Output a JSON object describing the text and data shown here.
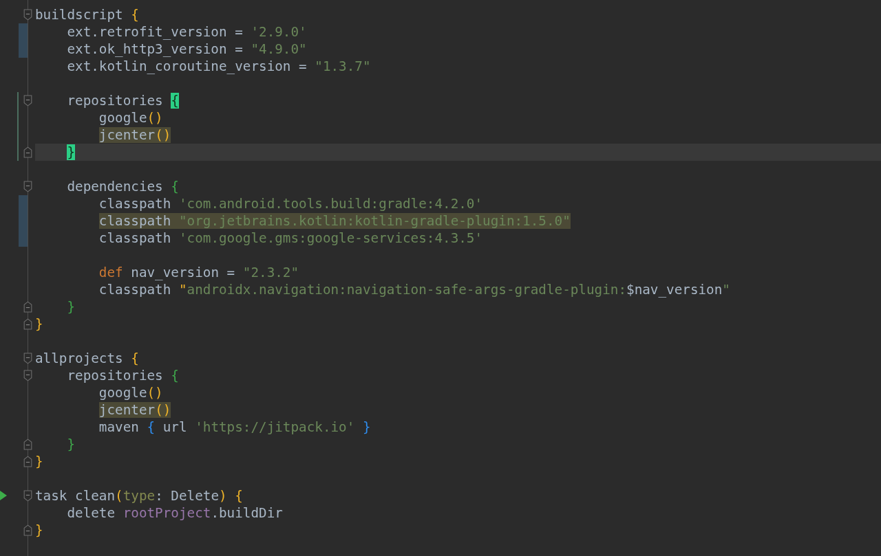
{
  "editor": {
    "lines": [
      {
        "kind": "code",
        "fold_start": true,
        "tokens": [
          {
            "text": "buildscript ",
            "kind": "plain"
          },
          {
            "text": "{",
            "kind": "brace-outer"
          }
        ],
        "children": [
          {
            "kind": "code",
            "modified": true,
            "tokens": [
              {
                "text": "ext.retrofit_version = ",
                "kind": "plain"
              },
              {
                "text": "'2.9.0'",
                "kind": "string"
              }
            ]
          },
          {
            "kind": "code",
            "modified": true,
            "tokens": [
              {
                "text": "ext.ok_http3_version = ",
                "kind": "plain"
              },
              {
                "text": "\"4.9.0\"",
                "kind": "string"
              }
            ]
          },
          {
            "kind": "code",
            "tokens": [
              {
                "text": "ext.kotlin_coroutine_version = ",
                "kind": "plain"
              },
              {
                "text": "\"1.3.7\"",
                "kind": "string"
              }
            ]
          },
          {
            "kind": "blank"
          },
          {
            "kind": "code",
            "fold_start": true,
            "added": true,
            "tokens": [
              {
                "text": "repositories ",
                "kind": "plain"
              },
              {
                "text": "{",
                "kind": "brace-inner",
                "matched": true
              }
            ],
            "children": [
              {
                "kind": "code",
                "added": true,
                "tokens": [
                  {
                    "text": "google",
                    "kind": "plain"
                  },
                  {
                    "text": "()",
                    "kind": "brace-outer"
                  }
                ]
              },
              {
                "kind": "code",
                "added": true,
                "tokens": [
                  {
                    "text": "jcenter",
                    "kind": "plain",
                    "highlighted": true
                  },
                  {
                    "text": "()",
                    "kind": "brace-outer",
                    "highlighted": true
                  }
                ]
              }
            ]
          },
          {
            "kind": "code",
            "fold_end": true,
            "added": true,
            "current": true,
            "tokens": [
              {
                "text": "}",
                "kind": "brace-inner",
                "matched": true
              }
            ]
          },
          {
            "kind": "blank"
          },
          {
            "kind": "code",
            "fold_start": true,
            "tokens": [
              {
                "text": "dependencies ",
                "kind": "plain"
              },
              {
                "text": "{",
                "kind": "brace-inner"
              }
            ],
            "children": [
              {
                "kind": "code",
                "modified": true,
                "tokens": [
                  {
                    "text": "classpath ",
                    "kind": "plain"
                  },
                  {
                    "text": "'com.android.tools.build:gradle:4.2.0'",
                    "kind": "string"
                  }
                ]
              },
              {
                "kind": "code",
                "modified": true,
                "tokens": [
                  {
                    "text": "classpath ",
                    "kind": "plain",
                    "highlighted": true
                  },
                  {
                    "text": "\"org.jetbrains.kotlin:kotlin-gradle-plugin:1.5.0\"",
                    "kind": "string",
                    "highlighted": true
                  }
                ]
              },
              {
                "kind": "code",
                "modified": true,
                "tokens": [
                  {
                    "text": "classpath ",
                    "kind": "plain"
                  },
                  {
                    "text": "'com.google.gms:google-services:4.3.5'",
                    "kind": "string"
                  }
                ]
              },
              {
                "kind": "blank"
              },
              {
                "kind": "code",
                "tokens": [
                  {
                    "text": "def",
                    "kind": "keyword"
                  },
                  {
                    "text": " nav_version = ",
                    "kind": "plain"
                  },
                  {
                    "text": "\"2.3.2\"",
                    "kind": "string"
                  }
                ]
              },
              {
                "kind": "code",
                "tokens": [
                  {
                    "text": "classpath ",
                    "kind": "plain"
                  },
                  {
                    "text": "\"",
                    "kind": "brace-outer"
                  },
                  {
                    "text": "androidx.navigation:navigation-safe-args-gradle-plugin:",
                    "kind": "string"
                  },
                  {
                    "text": "$nav_version",
                    "kind": "plain"
                  },
                  {
                    "text": "\"",
                    "kind": "string"
                  }
                ]
              }
            ]
          },
          {
            "kind": "code",
            "fold_end": true,
            "tokens": [
              {
                "text": "}",
                "kind": "brace-inner"
              }
            ]
          }
        ]
      },
      {
        "kind": "code",
        "fold_end": true,
        "tokens": [
          {
            "text": "}",
            "kind": "brace-outer"
          }
        ]
      },
      {
        "kind": "blank"
      },
      {
        "kind": "code",
        "fold_start": true,
        "tokens": [
          {
            "text": "allprojects ",
            "kind": "plain"
          },
          {
            "text": "{",
            "kind": "brace-outer"
          }
        ],
        "children": [
          {
            "kind": "code",
            "fold_start": true,
            "tokens": [
              {
                "text": "repositories ",
                "kind": "plain"
              },
              {
                "text": "{",
                "kind": "brace-inner"
              }
            ],
            "children": [
              {
                "kind": "code",
                "tokens": [
                  {
                    "text": "google",
                    "kind": "plain"
                  },
                  {
                    "text": "()",
                    "kind": "brace-outer"
                  }
                ]
              },
              {
                "kind": "code",
                "tokens": [
                  {
                    "text": "jcenter",
                    "kind": "plain",
                    "highlighted": true
                  },
                  {
                    "text": "()",
                    "kind": "brace-outer",
                    "highlighted": true
                  }
                ]
              },
              {
                "kind": "code",
                "tokens": [
                  {
                    "text": "maven ",
                    "kind": "plain"
                  },
                  {
                    "text": "{",
                    "kind": "brace-block"
                  },
                  {
                    "text": " url ",
                    "kind": "plain"
                  },
                  {
                    "text": "'https://jitpack.io'",
                    "kind": "string"
                  },
                  {
                    "text": " }",
                    "kind": "brace-block"
                  }
                ]
              }
            ]
          },
          {
            "kind": "code",
            "fold_end": true,
            "tokens": [
              {
                "text": "}",
                "kind": "brace-inner"
              }
            ]
          }
        ]
      },
      {
        "kind": "code",
        "fold_end": true,
        "tokens": [
          {
            "text": "}",
            "kind": "brace-outer"
          }
        ]
      },
      {
        "kind": "blank"
      },
      {
        "kind": "code",
        "fold_start": true,
        "run": true,
        "tokens": [
          {
            "text": "task clean",
            "kind": "plain"
          },
          {
            "text": "(",
            "kind": "brace-outer"
          },
          {
            "text": "type",
            "kind": "param"
          },
          {
            "text": ": Delete",
            "kind": "plain"
          },
          {
            "text": ")",
            "kind": "brace-outer"
          },
          {
            "text": " {",
            "kind": "brace-outer"
          }
        ],
        "children": [
          {
            "kind": "code",
            "tokens": [
              {
                "text": "delete ",
                "kind": "plain"
              },
              {
                "text": "rootProject",
                "kind": "field"
              },
              {
                "text": ".buildDir",
                "kind": "plain"
              }
            ]
          }
        ]
      },
      {
        "kind": "code",
        "fold_end": true,
        "tokens": [
          {
            "text": "}",
            "kind": "brace-outer"
          }
        ]
      }
    ]
  }
}
